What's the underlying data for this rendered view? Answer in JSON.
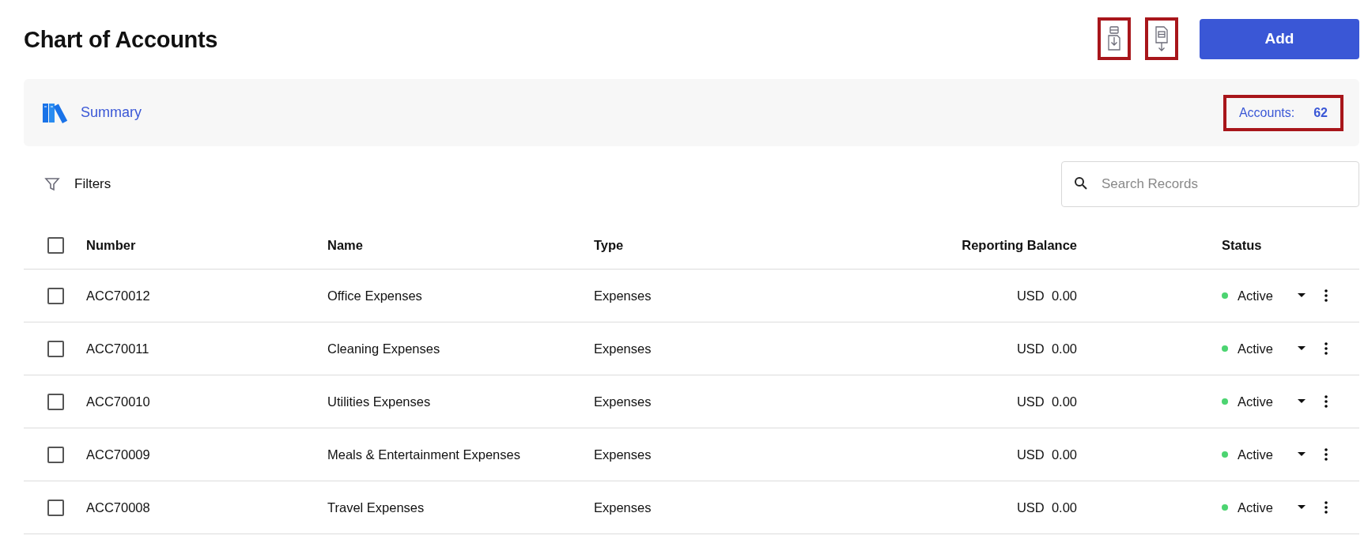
{
  "title": "Chart of Accounts",
  "actions": {
    "add_label": "Add"
  },
  "summary": {
    "label": "Summary",
    "count_label": "Accounts:",
    "count": "62"
  },
  "filters_label": "Filters",
  "search": {
    "placeholder": "Search Records"
  },
  "table": {
    "all_checked": false,
    "columns": [
      "Number",
      "Name",
      "Type",
      "Reporting Balance",
      "Status"
    ],
    "rows": [
      {
        "checked": false,
        "number": "ACC70012",
        "name": "Office Expenses",
        "type": "Expenses",
        "currency": "USD",
        "balance": "0.00",
        "status": "Active",
        "color": "#4cd471"
      },
      {
        "checked": false,
        "number": "ACC70011",
        "name": "Cleaning Expenses",
        "type": "Expenses",
        "currency": "USD",
        "balance": "0.00",
        "status": "Active",
        "color": "#4cd471"
      },
      {
        "checked": false,
        "number": "ACC70010",
        "name": "Utilities Expenses",
        "type": "Expenses",
        "currency": "USD",
        "balance": "0.00",
        "status": "Active",
        "color": "#4cd471"
      },
      {
        "checked": false,
        "number": "ACC70009",
        "name": "Meals & Entertainment Expenses",
        "type": "Expenses",
        "currency": "USD",
        "balance": "0.00",
        "status": "Active",
        "color": "#4cd471"
      },
      {
        "checked": false,
        "number": "ACC70008",
        "name": "Travel Expenses",
        "type": "Expenses",
        "currency": "USD",
        "balance": "0.00",
        "status": "Active",
        "color": "#4cd471"
      }
    ]
  }
}
